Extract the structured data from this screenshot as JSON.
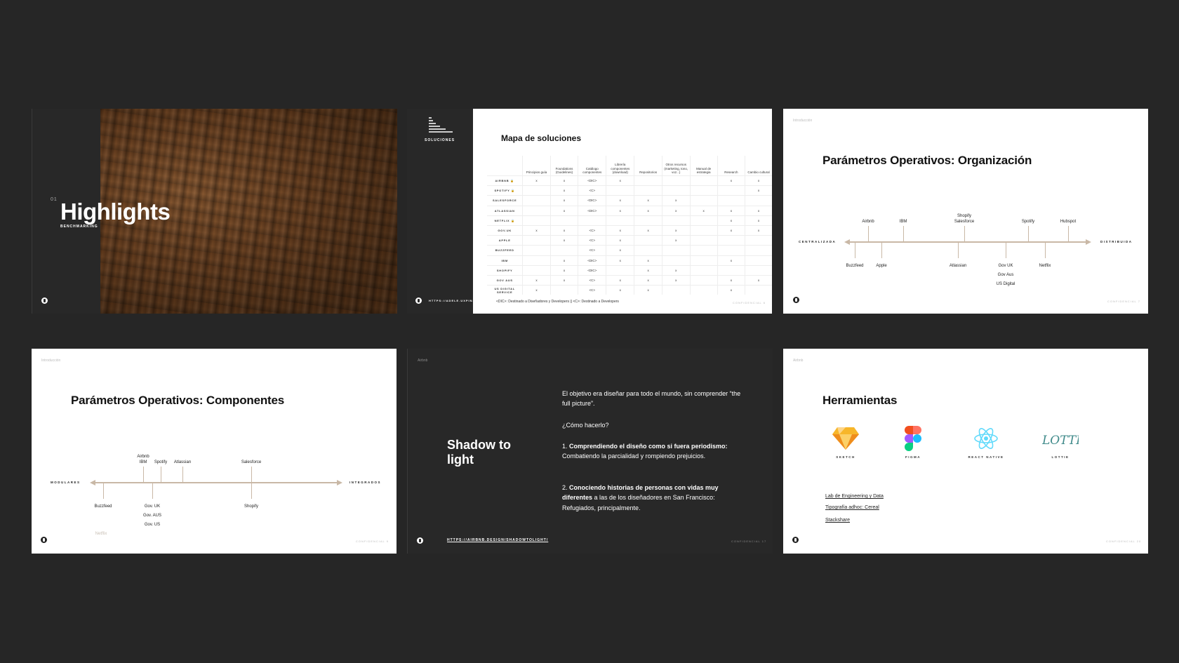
{
  "slide1": {
    "number": "01",
    "title": "Highlights",
    "subtitle": "BENCHMARKING"
  },
  "slide2": {
    "label": "SOLUCIONES",
    "title": "Mapa de soluciones",
    "url": "HTTPS://ADELE.UXPIN.C",
    "footnote": "<DIC>: Destinado a Diseñadores y Developers || <C>: Destinado a Developers",
    "confidential": "CONFIDENCIAL  6",
    "columns": [
      "Principios guía",
      "Foundations (Guidelines)",
      "Catálogo componentes",
      "Librería componentes (download)",
      "Repositorios",
      "Otros recursos (marketing, tono, voz...)",
      "Manual de estrategia",
      "Research",
      "Cambio cultural"
    ],
    "rows": [
      {
        "name": "AIRBNB 🔒",
        "cells": [
          "x",
          "x",
          "<DIC>",
          "x",
          "",
          "",
          "",
          "x",
          "x"
        ]
      },
      {
        "name": "SPOTIFY 🔒",
        "cells": [
          "",
          "x",
          "<C>",
          "",
          "",
          "",
          "",
          "",
          "x"
        ]
      },
      {
        "name": "SALESFORCE",
        "cells": [
          "",
          "x",
          "<DIC>",
          "x",
          "x",
          "x",
          "",
          "",
          ""
        ]
      },
      {
        "name": "ATLASSIAN",
        "cells": [
          "",
          "x",
          "<DIC>",
          "x",
          "x",
          "x",
          "x",
          "x",
          "x"
        ]
      },
      {
        "name": "NETFLIX 🔒",
        "cells": [
          "",
          "",
          "",
          "",
          "",
          "",
          "",
          "x",
          "x"
        ]
      },
      {
        "name": "GOV.UK",
        "cells": [
          "x",
          "x",
          "<C>",
          "x",
          "x",
          "x",
          "",
          "x",
          "x"
        ]
      },
      {
        "name": "APPLE",
        "cells": [
          "",
          "x",
          "<C>",
          "x",
          "",
          "x",
          "",
          "",
          ""
        ]
      },
      {
        "name": "BUZZFEED",
        "cells": [
          "",
          "",
          "<C>",
          "x",
          "",
          "",
          "",
          "",
          ""
        ]
      },
      {
        "name": "IBM",
        "cells": [
          "",
          "x",
          "<DIC>",
          "x",
          "x",
          "",
          "",
          "x",
          ""
        ]
      },
      {
        "name": "SHOPIFY",
        "cells": [
          "",
          "x",
          "<DIC>",
          "",
          "x",
          "x",
          "",
          "",
          ""
        ]
      },
      {
        "name": "GOV AUS",
        "cells": [
          "x",
          "x",
          "<C>",
          "x",
          "x",
          "x",
          "",
          "x",
          "x"
        ]
      },
      {
        "name": "US DIGITAL SERVICE",
        "cells": [
          "x",
          "",
          "<C>",
          "x",
          "x",
          "",
          "",
          "x",
          ""
        ]
      }
    ]
  },
  "slide3": {
    "crumb": "Introducción",
    "title": "Parámetros Operativos: Organización",
    "left": "CENTRALIZADA",
    "right": "DISTRIBUIDA",
    "above": [
      "Airbnb",
      "IBM",
      "Shopify\nSalesforce",
      "Spotify",
      "Hubspot"
    ],
    "below": [
      "Buzzfeed",
      "Apple",
      "Atlassian",
      "Gov UK\nGov Aus\nUS Digital",
      "Netflix"
    ],
    "confidential": "CONFIDENCIAL  7"
  },
  "slide4": {
    "crumb": "Introducción",
    "title": "Parámetros Operativos: Componentes",
    "left": "MODULARES",
    "right": "INTEGRADOS",
    "above": [
      "Airbnb\nIBM",
      "Spotify",
      "Atlassian",
      "Salesforce"
    ],
    "below": [
      "Buzzfeed",
      "Gov. UK\nGov. AUS\nGov. US",
      "Shopify"
    ],
    "faded": "Netflix",
    "confidential": "CONFIDENCIAL  9"
  },
  "slide5": {
    "crumb": "Airbnb",
    "title": "Shadow to\nlight",
    "p1": "El objetivo era diseñar para todo el mundo, sin comprender “the full picture”.",
    "p2": "¿Cómo hacerlo?",
    "p3_num": "1. ",
    "p3_bold": "Comprendiendo el diseño como si fuera periodismo:",
    "p3_rest": " Combatiendo la parcialidad y rompiendo prejuicios.",
    "p4_num": "2. ",
    "p4_bold": "Conociendo historias de personas con vidas muy diferentes",
    "p4_rest": " a las de los diseñadores en San Francisco: Refugiados, principalmente.",
    "url": "HTTPS://AIRBNB.DESIGN/SHADOWTOLIGHT/",
    "confidential": "CONFIDENCIAL  17"
  },
  "slide6": {
    "crumb": "Airbnb",
    "title": "Herramientas",
    "tools": [
      "SKETCH",
      "FIGMA",
      "REACT NATIVE",
      "LOTTIE"
    ],
    "lottie_logo": "LOTTIE",
    "links": [
      "Lab de Engineering y Data",
      "Tipografía adhoc: Cereal",
      "Stackshare"
    ],
    "confidential": "CONFIDENCIAL  20"
  }
}
